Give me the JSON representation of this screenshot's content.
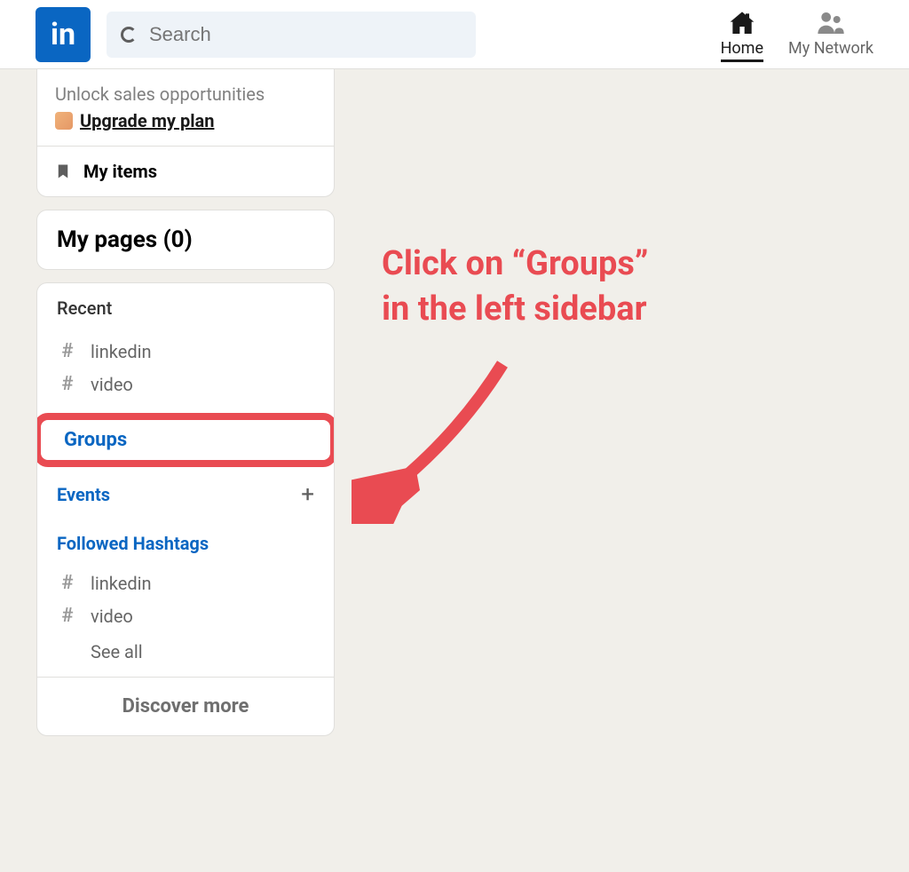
{
  "header": {
    "search_placeholder": "Search",
    "nav": {
      "home": "Home",
      "network": "My Network"
    }
  },
  "sidebar": {
    "promo_line1": "Unlock sales opportunities",
    "promo_link": "Upgrade my plan",
    "my_items": "My items",
    "my_pages_label": "My pages (0)",
    "recent_label": "Recent",
    "recent_items": [
      "linkedin",
      "video"
    ],
    "groups_label": "Groups",
    "events_label": "Events",
    "followed_label": "Followed Hashtags",
    "followed_items": [
      "linkedin",
      "video"
    ],
    "see_all": "See all",
    "discover": "Discover more"
  },
  "annotation": {
    "line1": "Click on “Groups”",
    "line2": "in the left sidebar"
  }
}
